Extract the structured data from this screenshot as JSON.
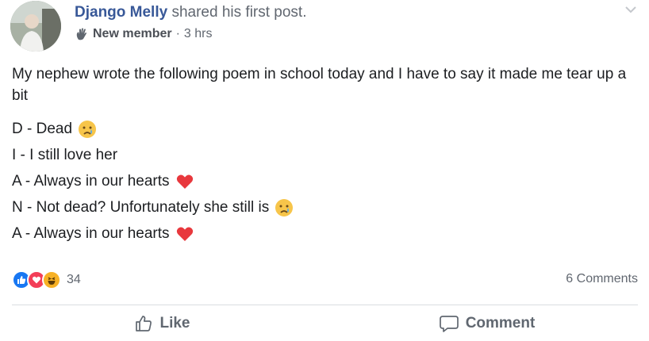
{
  "post": {
    "author": "Django Melly",
    "action": "shared his first post.",
    "badge": "New member",
    "separator": "·",
    "time": "3 hrs",
    "intro": "My nephew wrote the following poem in school today and I have to say it made me tear up a bit",
    "poem": [
      {
        "text": "D - Dead",
        "emoji": "crying-face"
      },
      {
        "text": "I - I still love her",
        "emoji": ""
      },
      {
        "text": "A - Always in our hearts",
        "emoji": "red-heart"
      },
      {
        "text": "N - Not dead? Unfortunately she still is",
        "emoji": "crying-face"
      },
      {
        "text": "A - Always in our hearts",
        "emoji": "red-heart"
      }
    ]
  },
  "reactions": {
    "types": [
      "like",
      "love",
      "haha"
    ],
    "count": "34",
    "comments": "6 Comments"
  },
  "actions": {
    "like_label": "Like",
    "comment_label": "Comment"
  },
  "colors": {
    "author": "#385898",
    "like": "#1877f2",
    "love": "#f33e58",
    "haha": "#f7b125",
    "meta": "#616770"
  }
}
